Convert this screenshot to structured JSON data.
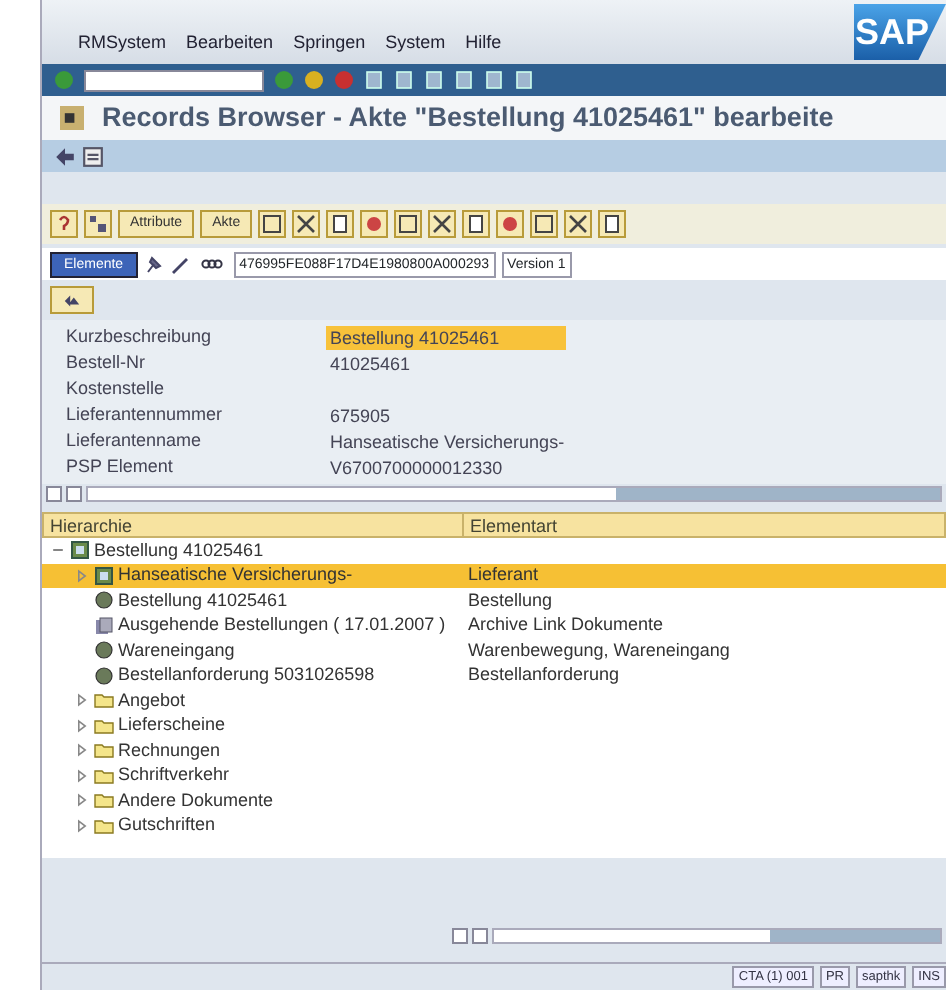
{
  "menu": [
    "RMSystem",
    "Bearbeiten",
    "Springen",
    "System",
    "Hilfe"
  ],
  "logo": "SAP",
  "window": {
    "title": "Records Browser - Akte \"Bestellung 41025461\" bearbeite"
  },
  "app_toolbar": {
    "buttons": [
      "Attribute",
      "Akte"
    ]
  },
  "record_bar": {
    "mode_button": "Elemente",
    "id": "476995FE088F17D4E1980800A000293",
    "version": "Version 1"
  },
  "attributes": [
    {
      "label": "Kurzbeschreibung",
      "value": "Bestellung 41025461",
      "selected": true
    },
    {
      "label": "Bestell-Nr",
      "value": "41025461",
      "selected": false
    },
    {
      "label": "Kostenstelle",
      "selected": false
    },
    {
      "label": "Lieferantennummer",
      "value": "675905",
      "selected": false
    },
    {
      "label": "Lieferantenname",
      "value": "Hanseatische Versicherungs-",
      "selected": false
    },
    {
      "label": "PSP Element",
      "value": "V6700700000012330",
      "selected": false
    }
  ],
  "tree": {
    "columns": [
      "Hierarchie",
      "Elementart"
    ],
    "nodes": [
      {
        "kind": "record",
        "label": "Bestellung 41025461",
        "expanded": true,
        "selected": false,
        "children": [
          {
            "kind": "record",
            "label": "Hanseatische Versicherungs-",
            "type": "Lieferant",
            "expanded": false,
            "selected": true
          },
          {
            "kind": "object",
            "label": "Bestellung 41025461",
            "type": "Bestellung",
            "selected": false
          },
          {
            "kind": "document",
            "label": "Ausgehende Bestellungen ( 17.01.2007 )",
            "type": "Archive Link Dokumente",
            "selected": false
          },
          {
            "kind": "object",
            "label": "Wareneingang",
            "type": "Warenbewegung, Wareneingang",
            "selected": false
          },
          {
            "kind": "object",
            "label": "Bestellanforderung 5031026598",
            "type": "Bestellanforderung",
            "selected": false
          },
          {
            "kind": "folder",
            "label": "Angebot",
            "expanded": false,
            "selected": false
          },
          {
            "kind": "folder",
            "label": "Lieferscheine",
            "expanded": false,
            "selected": false
          },
          {
            "kind": "folder",
            "label": "Rechnungen",
            "expanded": false,
            "selected": false
          },
          {
            "kind": "folder",
            "label": "Schriftverkehr",
            "expanded": false,
            "selected": false
          },
          {
            "kind": "folder",
            "label": "Andere Dokumente",
            "expanded": false,
            "selected": false
          },
          {
            "kind": "folder",
            "label": "Gutschriften",
            "expanded": false,
            "selected": false
          }
        ]
      }
    ]
  },
  "status_bar": [
    "CTA (1) 001",
    "PR",
    "sapthk",
    "INS"
  ]
}
